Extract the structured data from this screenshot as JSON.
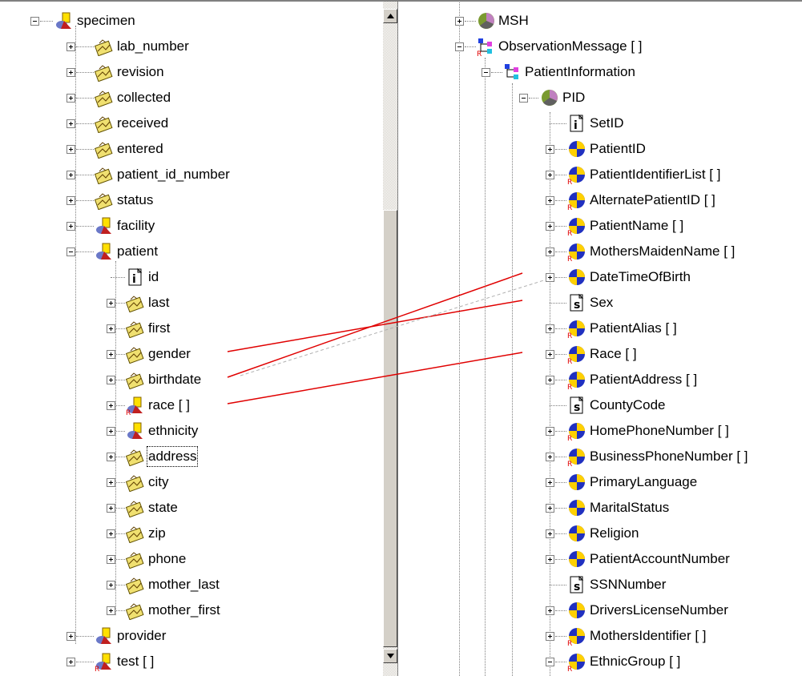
{
  "left_tree": {
    "root": "specimen",
    "children": [
      "lab_number",
      "revision",
      "collected",
      "received",
      "entered",
      "patient_id_number",
      "status",
      "facility"
    ],
    "patient": "patient",
    "patient_children": [
      "id",
      "last",
      "first",
      "gender",
      "birthdate",
      "race [ ]",
      "ethnicity",
      "address",
      "city",
      "state",
      "zip",
      "phone",
      "mother_last",
      "mother_first"
    ],
    "after": [
      "provider",
      "test [ ]"
    ]
  },
  "right_tree": {
    "msh": "MSH",
    "observation_message": "ObservationMessage [ ]",
    "patient_information": "PatientInformation",
    "pid": "PID",
    "pid_children": [
      "SetID",
      "PatientID",
      "PatientIdentifierList [ ]",
      "AlternatePatientID [ ]",
      "PatientName [ ]",
      "MothersMaidenName [ ]",
      "DateTimeOfBirth",
      "Sex",
      "PatientAlias [ ]",
      "Race [ ]",
      "PatientAddress [ ]",
      "CountyCode",
      "HomePhoneNumber [ ]",
      "BusinessPhoneNumber [ ]",
      "PrimaryLanguage",
      "MaritalStatus",
      "Religion",
      "PatientAccountNumber",
      "SSNNumber",
      "DriversLicenseNumber",
      "MothersIdentifier [ ]",
      "EthnicGroup [ ]"
    ]
  },
  "colors": {
    "mapping_line": "#e00000",
    "dashed_line": "#b0b0b0",
    "scroll_face": "#d4d0c8"
  }
}
